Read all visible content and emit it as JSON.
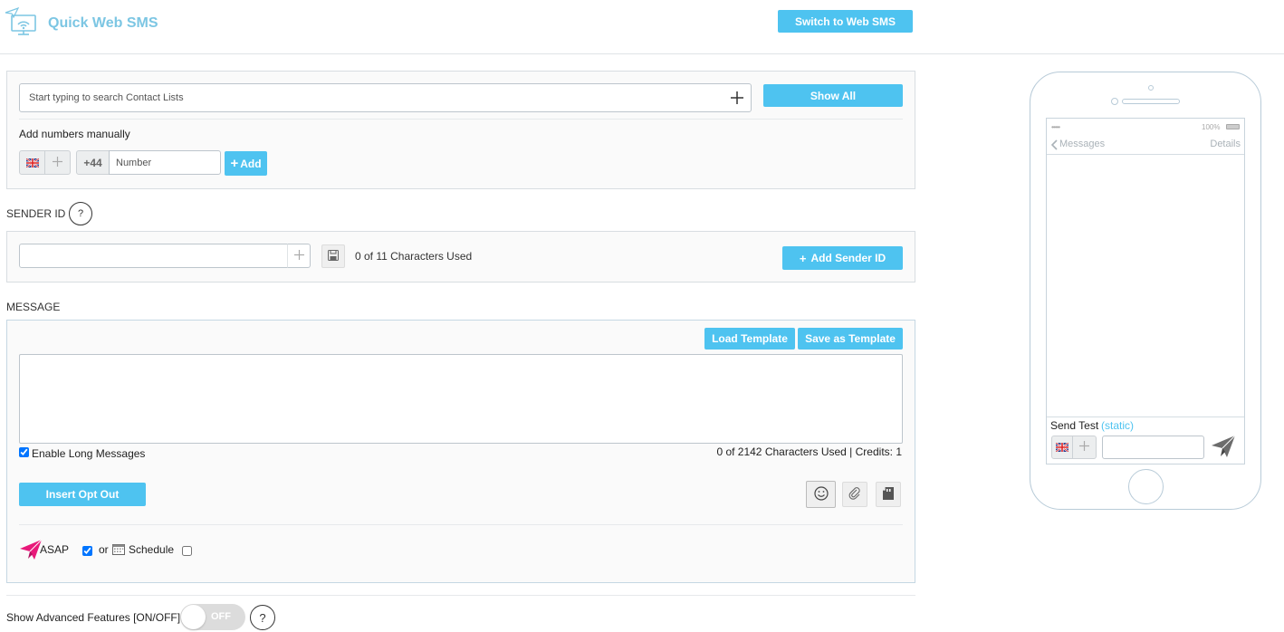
{
  "header": {
    "title": "Quick Web SMS",
    "switch_button": "Switch to Web SMS"
  },
  "recipients": {
    "search_placeholder": "Start typing to search Contact Lists",
    "show_all_button": "Show All",
    "manual_label": "Add numbers manually",
    "country_code": "+44",
    "number_placeholder": "Number",
    "add_button": "Add"
  },
  "sender": {
    "section_label": "SENDER ID",
    "help": "?",
    "chars_used": "0 of 11 Characters Used",
    "add_sender_button": "Add Sender ID"
  },
  "message": {
    "section_label": "MESSAGE",
    "load_template_button": "Load Template",
    "save_template_button": "Save as Template",
    "text": "",
    "enable_long_label": "Enable Long Messages",
    "enable_long_checked": true,
    "chars_info": "0 of 2142 Characters Used | Credits: 1",
    "opt_out_button": "Insert Opt Out",
    "asap_label": "ASAP",
    "asap_checked": true,
    "or_label": "or",
    "schedule_label": "Schedule",
    "schedule_checked": false
  },
  "advanced": {
    "label": "Show Advanced Features [ON/OFF]",
    "toggle_label": "OFF",
    "help": "?"
  },
  "phone_preview": {
    "signal": "•••••",
    "battery": "100%",
    "back_label": "Messages",
    "details_label": "Details",
    "send_test_label": "Send Test",
    "send_test_note": "(static)"
  },
  "colors": {
    "accent": "#4ec3f0",
    "title": "#7cc6e3",
    "brand_pink": "#e8197a"
  }
}
